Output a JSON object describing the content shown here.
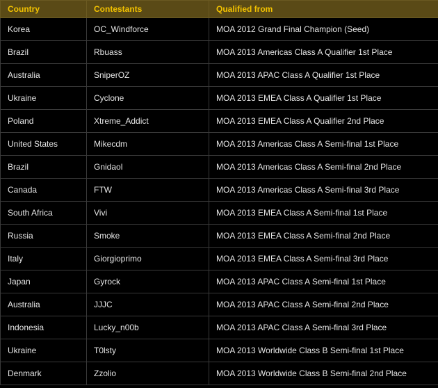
{
  "table": {
    "headers": [
      "Country",
      "Contestants",
      "Qualified from"
    ],
    "rows": [
      [
        "Korea",
        "OC_Windforce",
        "MOA 2012 Grand Final Champion (Seed)"
      ],
      [
        "Brazil",
        "Rbuass",
        "MOA 2013 Americas Class A Qualifier 1st Place"
      ],
      [
        "Australia",
        "SniperOZ",
        "MOA 2013 APAC Class A Qualifier 1st Place"
      ],
      [
        "Ukraine",
        "Cyclone",
        "MOA 2013 EMEA Class A Qualifier 1st Place"
      ],
      [
        "Poland",
        "Xtreme_Addict",
        "MOA 2013 EMEA Class A Qualifier 2nd Place"
      ],
      [
        "United States",
        "Mikecdm",
        "MOA 2013 Americas Class A Semi-final 1st Place"
      ],
      [
        "Brazil",
        "Gnidaol",
        "MOA 2013 Americas Class A Semi-final 2nd Place"
      ],
      [
        "Canada",
        "FTW",
        "MOA 2013 Americas Class A Semi-final 3rd Place"
      ],
      [
        "South Africa",
        "Vivi",
        "MOA 2013 EMEA Class A Semi-final 1st Place"
      ],
      [
        "Russia",
        "Smoke",
        "MOA 2013 EMEA Class A Semi-final 2nd Place"
      ],
      [
        "Italy",
        "Giorgioprimo",
        "MOA 2013 EMEA Class A Semi-final 3rd Place"
      ],
      [
        "Japan",
        "Gyrock",
        "MOA 2013 APAC Class A Semi-final 1st Place"
      ],
      [
        "Australia",
        "JJJC",
        "MOA 2013 APAC Class A Semi-final 2nd Place"
      ],
      [
        "Indonesia",
        "Lucky_n00b",
        "MOA 2013 APAC Class A Semi-final 3rd Place"
      ],
      [
        "Ukraine",
        "T0lsty",
        "MOA 2013 Worldwide Class B Semi-final 1st Place"
      ],
      [
        "Denmark",
        "Zzolio",
        "MOA 2013 Worldwide Class B Semi-final 2nd Place"
      ]
    ]
  },
  "colors": {
    "header_bg": "#5a4a16",
    "header_text": "#f2c200",
    "body_bg": "#000000",
    "body_text": "#e6e6e6",
    "grid": "#3a3a3a"
  }
}
